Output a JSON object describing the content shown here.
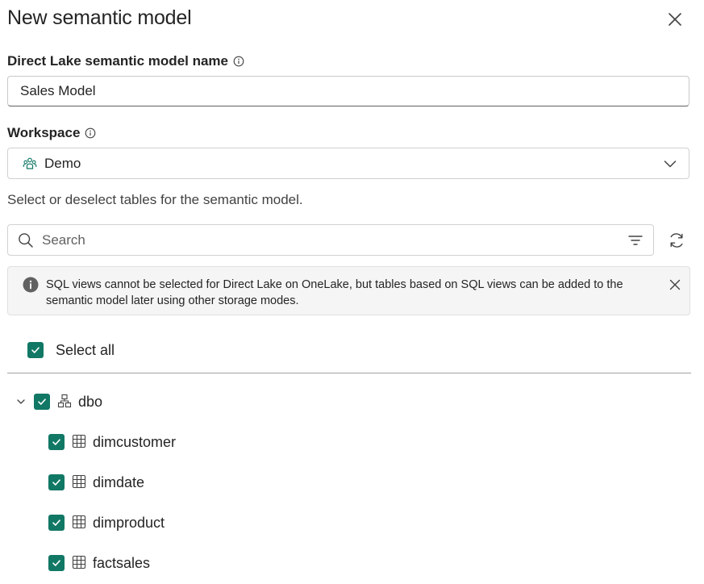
{
  "dialog": {
    "title": "New semantic model"
  },
  "model_name": {
    "label": "Direct Lake semantic model name",
    "value": "Sales Model"
  },
  "workspace": {
    "label": "Workspace",
    "selected": "Demo"
  },
  "tables_hint": "Select or deselect tables for the semantic model.",
  "search": {
    "placeholder": "Search",
    "value": ""
  },
  "banner": {
    "text": "SQL views cannot be selected for Direct Lake on OneLake, but tables based on SQL views can be added to the semantic model later using other storage modes."
  },
  "select_all": {
    "label": "Select all",
    "checked": true
  },
  "schema": {
    "name": "dbo",
    "expanded": true,
    "checked": true,
    "tables": [
      {
        "name": "dimcustomer",
        "checked": true
      },
      {
        "name": "dimdate",
        "checked": true
      },
      {
        "name": "dimproduct",
        "checked": true
      },
      {
        "name": "factsales",
        "checked": true
      }
    ]
  },
  "colors": {
    "accent": "#117865",
    "text": "#242424",
    "banner_bg": "#f5f5f5"
  }
}
